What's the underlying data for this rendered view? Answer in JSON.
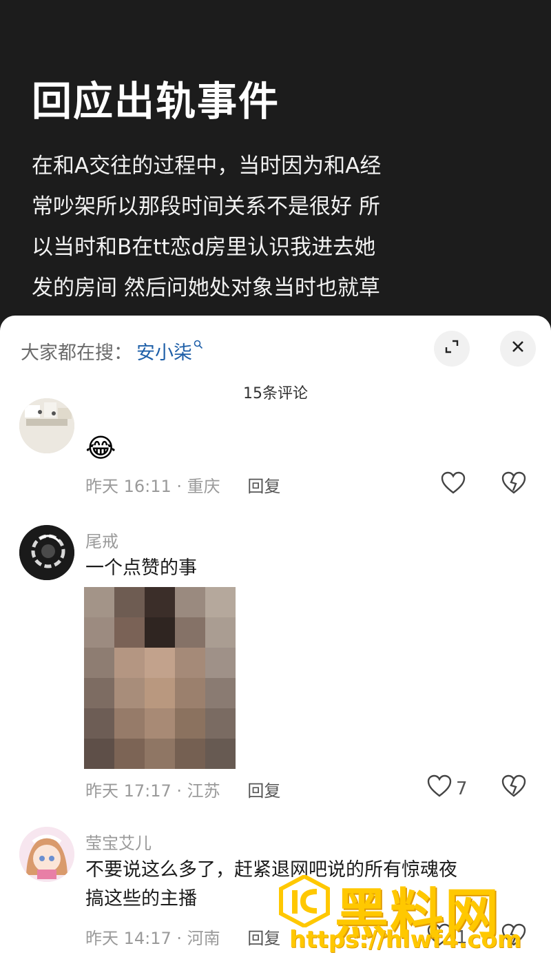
{
  "post": {
    "title": "回应出轨事件",
    "body_lines": [
      "在和A交往的过程中，当时因为和A经",
      "常吵架所以那段时间关系不是很好 所",
      "以当时和B在tt恋d房里认识我进去她",
      "发的房间 然后问她处对象当时也就草"
    ]
  },
  "sheet": {
    "search_label": "大家都在搜：",
    "search_term": "安小柒",
    "count_title": "15条评论"
  },
  "comments": [
    {
      "username": "",
      "text": "😂",
      "time_loc": "昨天 16:11 · 重庆",
      "reply": "回复",
      "likes": ""
    },
    {
      "username": "尾戒",
      "text": "一个点赞的事",
      "time_loc": "昨天 17:17 · 江苏",
      "reply": "回复",
      "likes": "7"
    },
    {
      "username": "莹宝艾儿",
      "text_lines": [
        "不要说这么多了，赶紧退网吧说的所有惊魂夜",
        "搞这些的主播"
      ],
      "time_loc": "昨天 14:17 · 河南",
      "reply": "回复",
      "likes": "1"
    }
  ],
  "watermark": {
    "brand": "黑料网",
    "url": "https://hlwf4.com"
  },
  "icons": {
    "expand": "expand-icon",
    "close": "close-icon",
    "like": "heart-icon",
    "dislike": "broken-heart-icon"
  },
  "colors": {
    "post_bg": "#1c1c1c",
    "search_term": "#1e5fa8",
    "watermark": "#ffc800"
  }
}
